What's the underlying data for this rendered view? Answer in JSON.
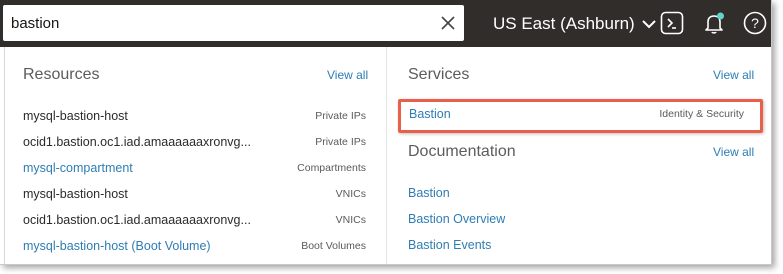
{
  "search": {
    "value": "bastion"
  },
  "header": {
    "region": "US East (Ashburn)",
    "icons": [
      "cloud-shell-icon",
      "bell-icon",
      "help-icon"
    ],
    "notification_dot_color": "#5fd5c8"
  },
  "resources": {
    "title": "Resources",
    "view_all": "View all",
    "items": [
      {
        "name": "mysql-bastion-host",
        "type": "Private IPs",
        "link": false
      },
      {
        "name": "ocid1.bastion.oc1.iad.amaaaaaaxronvg...",
        "type": "Private IPs",
        "link": false
      },
      {
        "name": "mysql-compartment",
        "type": "Compartments",
        "link": true
      },
      {
        "name": "mysql-bastion-host",
        "type": "VNICs",
        "link": false
      },
      {
        "name": "ocid1.bastion.oc1.iad.amaaaaaaxronvg...",
        "type": "VNICs",
        "link": false
      },
      {
        "name": "mysql-bastion-host (Boot Volume)",
        "type": "Boot Volumes",
        "link": true
      }
    ]
  },
  "services": {
    "title": "Services",
    "view_all": "View all",
    "items": [
      {
        "name": "Bastion",
        "category": "Identity & Security"
      }
    ]
  },
  "documentation": {
    "title": "Documentation",
    "view_all": "View all",
    "items": [
      "Bastion",
      "Bastion Overview",
      "Bastion Events"
    ]
  },
  "colors": {
    "topbar": "#312d2a",
    "link": "#2e7db3",
    "highlight": "#e8604c"
  }
}
